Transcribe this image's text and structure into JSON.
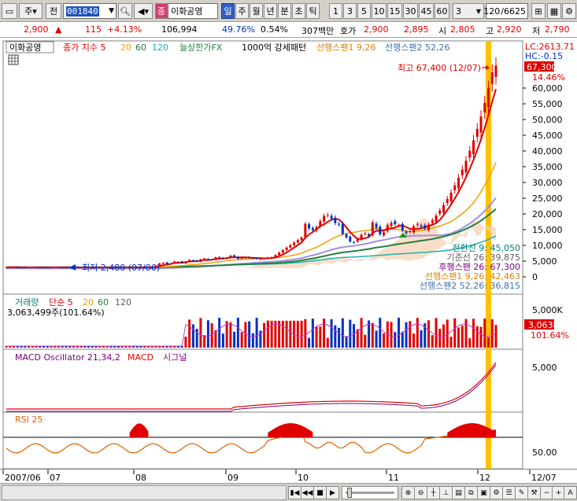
{
  "toolbar": {
    "market_label": "주",
    "prev_label": "전",
    "code_value": "001840",
    "stock_badge": "종",
    "stock_name": "이화공영",
    "periods": [
      "일",
      "주",
      "월",
      "년",
      "분",
      "초",
      "틱"
    ],
    "active_period": "일",
    "intervals": [
      "1",
      "3",
      "5",
      "10",
      "15",
      "30",
      "45",
      "60"
    ],
    "interval_select": "3",
    "count_value": "120",
    "count_total": "/6625"
  },
  "quote": {
    "price": "2,900",
    "change": "115",
    "change_pct": "+4.13%",
    "volume": "106,994",
    "volume_ratio": "49.76%",
    "turnover": "0.54%",
    "amount": "307백만",
    "ask_label": "호가",
    "ask1": "2,900",
    "ask2": "2,895",
    "open_label": "시",
    "open": "2,805",
    "high_label": "고",
    "high": "2,920",
    "low_label": "저",
    "low": "2,790"
  },
  "price_panel": {
    "stock_tag": "이화공영",
    "legend_close": "종가 지수 5",
    "ma_periods": [
      "20",
      "60",
      "120"
    ],
    "legend_parabolic": "늘상한가FX",
    "legend_pattern": "1000억 강세패턴",
    "legend_span1": "선행스팬1 9,26",
    "legend_span2": "선행스팬2 52,26",
    "lc_label": "LC:2613.71",
    "hc_label": "HC:-0.15",
    "last_price": "67,300",
    "last_pct": "14.46%",
    "high_annotation": "최고 67,400 (12/07)",
    "low_annotation": "최저 2,480 (07/06)",
    "y_ticks": [
      "60,000",
      "55,000",
      "50,000",
      "45,000",
      "40,000",
      "35,000",
      "30,000",
      "25,000",
      "20,000",
      "15,000",
      "10,000",
      "5,000",
      "0"
    ],
    "ichimoku": [
      {
        "label": "전환선 9: 45,050",
        "color": "#008080"
      },
      {
        "label": "기준선 26: 39,875",
        "color": "#606060"
      },
      {
        "label": "후행스팬 26: 67,300",
        "color": "#800080"
      },
      {
        "label": "선행스팬1 9,26: 42,463",
        "color": "#e08000"
      },
      {
        "label": "선행스팬2 52,26: 36,815",
        "color": "#4070b0"
      }
    ]
  },
  "volume_panel": {
    "title": "거래량",
    "legend_ma": "단순 5",
    "ma_periods": [
      "20",
      "60",
      "120"
    ],
    "value_text": "3,063,499주(101.64%)",
    "y_tick": "5,000K",
    "last_value": "3,063K",
    "last_pct": "101.64%"
  },
  "macd_panel": {
    "title": "MACD Oscillator 21,34,2",
    "legend_macd": "MACD",
    "legend_signal": "시그널",
    "y_tick": "5,000"
  },
  "rsi_panel": {
    "title": "RSI 25",
    "y_tick": "50.00"
  },
  "time_axis": {
    "labels": [
      "2007/06",
      "07",
      "08",
      "09",
      "10",
      "11",
      "12",
      "12/07"
    ]
  },
  "colors": {
    "up": "#e00000",
    "down": "#0030c0",
    "highlight": "#ffc000",
    "ma5": "#e00000",
    "ma20": "#f0a000",
    "ma60": "#208040",
    "ma120": "#20b0b0"
  },
  "chart_data": {
    "type": "line",
    "price_series": {
      "name": "종가",
      "x": [
        "2007/06",
        "07",
        "08",
        "09",
        "10",
        "11",
        "12"
      ],
      "values": [
        2600,
        2500,
        5500,
        6000,
        13000,
        17000,
        67300
      ]
    },
    "ylim": [
      0,
      67400
    ],
    "grid": false
  }
}
